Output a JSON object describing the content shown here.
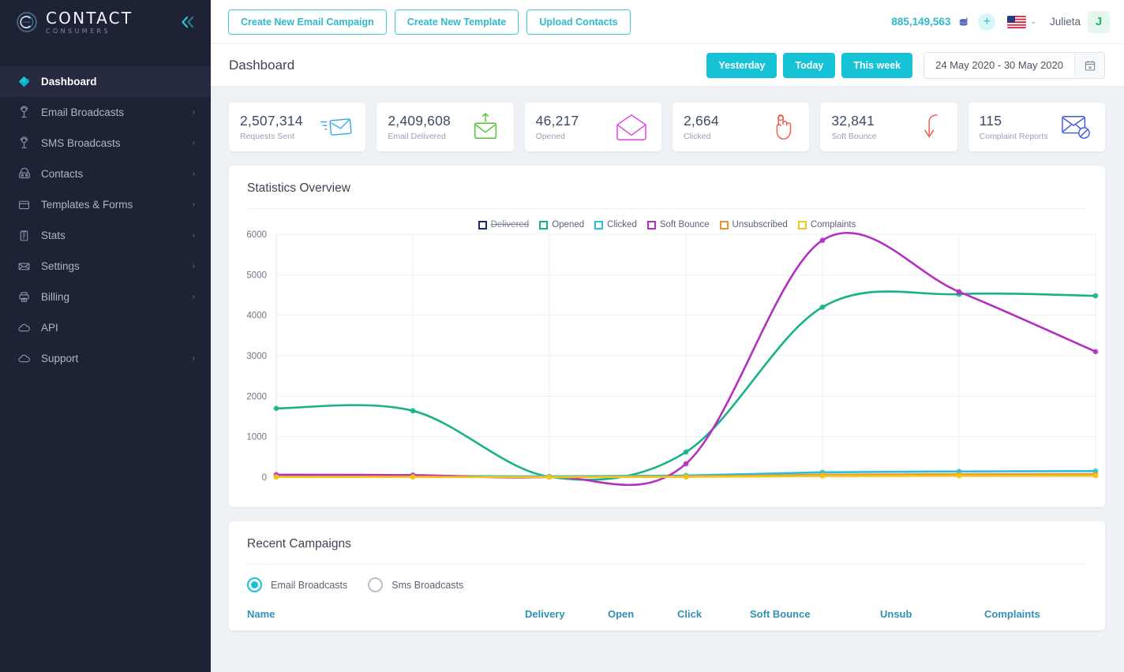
{
  "sidebar": {
    "logo": {
      "main": "CONTACT",
      "sub": "CONSUMERS"
    },
    "collapse_label": "«",
    "items": [
      {
        "label": "Dashboard",
        "icon": "diamond-icon",
        "active": true,
        "caret": ""
      },
      {
        "label": "Email Broadcasts",
        "icon": "broadcast-icon",
        "active": false,
        "caret": "›"
      },
      {
        "label": "SMS Broadcasts",
        "icon": "broadcast-icon",
        "active": false,
        "caret": "›"
      },
      {
        "label": "Contacts",
        "icon": "contacts-icon",
        "active": false,
        "caret": "›"
      },
      {
        "label": "Templates & Forms",
        "icon": "window-icon",
        "active": false,
        "caret": "›"
      },
      {
        "label": "Stats",
        "icon": "clipboard-icon",
        "active": false,
        "caret": "›"
      },
      {
        "label": "Settings",
        "icon": "envelope-icon",
        "active": false,
        "caret": "›"
      },
      {
        "label": "Billing",
        "icon": "printer-icon",
        "active": false,
        "caret": "›"
      },
      {
        "label": "API",
        "icon": "cloud-icon",
        "active": false,
        "caret": ""
      },
      {
        "label": "Support",
        "icon": "cloud-icon",
        "active": false,
        "caret": "›"
      }
    ]
  },
  "topbar": {
    "buttons": [
      {
        "label": "Create New Email Campaign"
      },
      {
        "label": "Create New Template"
      },
      {
        "label": "Upload Contacts"
      }
    ],
    "credits": "885,149,563",
    "credits_icon": "coins-icon",
    "add_icon": "plus-icon",
    "flag_icon": "us-flag-icon",
    "flag_caret": "⌄",
    "username": "Julieta",
    "avatar_initial": "J"
  },
  "pagehead": {
    "title": "Dashboard",
    "chips": [
      {
        "label": "Yesterday"
      },
      {
        "label": "Today"
      },
      {
        "label": "This week"
      }
    ],
    "date_range": "24 May 2020 - 30 May 2020",
    "calendar_icon": "calendar-icon"
  },
  "kpis": [
    {
      "value": "2,507,314",
      "label": "Requests Sent",
      "icon": "send-envelope-icon",
      "color": "#31a9e8"
    },
    {
      "value": "2,409,608",
      "label": "Email Delivered",
      "icon": "delivered-envelope-icon",
      "color": "#4dc335"
    },
    {
      "value": "46,217",
      "label": "Opened",
      "icon": "open-envelope-icon",
      "color": "#e040e0"
    },
    {
      "value": "2,664",
      "label": "Clicked",
      "icon": "click-hand-icon",
      "color": "#f4564a"
    },
    {
      "value": "32,841",
      "label": "Soft Bounce",
      "icon": "bounce-arrow-icon",
      "color": "#f4564a"
    },
    {
      "value": "115",
      "label": "Complaint Reports",
      "icon": "blocked-envelope-icon",
      "color": "#3f55e0"
    }
  ],
  "statistics": {
    "title": "Statistics Overview"
  },
  "chart_data": {
    "type": "line",
    "title": "Statistics Overview",
    "xlabel": "",
    "ylabel": "",
    "ylim": [
      0,
      6000
    ],
    "yticks": [
      0,
      1000,
      2000,
      3000,
      4000,
      5000,
      6000
    ],
    "grid": true,
    "legend_position": "top",
    "x": [
      1,
      2,
      3,
      4,
      5,
      6,
      7
    ],
    "series": [
      {
        "name": "Delivered",
        "color": "#1b2a6b",
        "disabled": true,
        "values": [
          0,
          0,
          0,
          0,
          0,
          0,
          0
        ]
      },
      {
        "name": "Opened",
        "color": "#17b18a",
        "disabled": false,
        "values": [
          1700,
          1640,
          10,
          620,
          4200,
          4520,
          4480
        ]
      },
      {
        "name": "Clicked",
        "color": "#24c0e0",
        "disabled": false,
        "values": [
          30,
          30,
          20,
          40,
          120,
          140,
          150
        ]
      },
      {
        "name": "Soft Bounce",
        "color": "#b game",
        "disabled": false,
        "values": [
          60,
          50,
          5,
          330,
          5850,
          4580,
          3100
        ]
      },
      {
        "name": "Unsubscribed",
        "color": "#f0922c",
        "disabled": false,
        "values": [
          10,
          10,
          5,
          15,
          60,
          70,
          75
        ]
      },
      {
        "name": "Complaints",
        "color": "#f5c518",
        "disabled": false,
        "values": [
          5,
          5,
          2,
          8,
          30,
          35,
          38
        ]
      }
    ]
  },
  "recent": {
    "title": "Recent Campaigns",
    "radios": [
      {
        "label": "Email Broadcasts",
        "selected": true
      },
      {
        "label": "Sms Broadcasts",
        "selected": false
      }
    ],
    "columns": [
      "Name",
      "Delivery",
      "Open",
      "Click",
      "Soft Bounce",
      "Unsub",
      "Complaints"
    ]
  }
}
